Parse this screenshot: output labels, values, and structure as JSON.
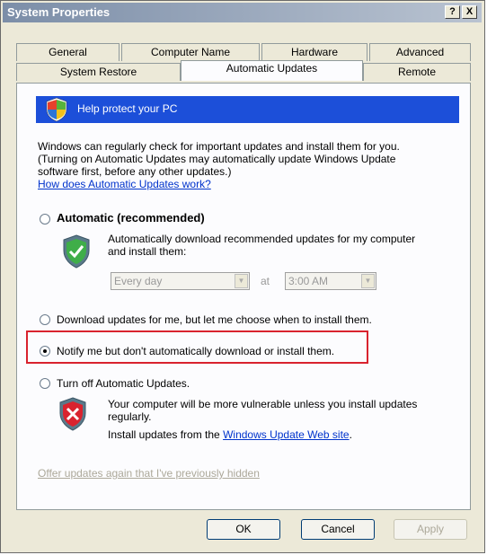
{
  "window": {
    "title": "System Properties",
    "help_button": "?",
    "close_button": "X"
  },
  "tabs": {
    "row1": [
      "General",
      "Computer Name",
      "Hardware",
      "Advanced"
    ],
    "row2": [
      "System Restore",
      "Automatic Updates",
      "Remote"
    ],
    "active": "Automatic Updates"
  },
  "banner": {
    "text": "Help protect your PC",
    "icon": "shield-icon"
  },
  "intro": {
    "line1": "Windows can regularly check for important updates and install them for you.",
    "line2": "(Turning on Automatic Updates may automatically update Windows Update",
    "line3": "software first, before any other updates.)",
    "link": "How does Automatic Updates work?"
  },
  "options": {
    "automatic": {
      "label": "Automatic (recommended)",
      "desc1": "Automatically download recommended updates for my computer",
      "desc2": "and install them:",
      "frequency": "Every day",
      "at_label": "at",
      "time": "3:00 AM",
      "checked": false
    },
    "download": {
      "label": "Download updates for me, but let me choose when to install them.",
      "checked": false
    },
    "notify": {
      "label": "Notify me but don't automatically download or install them.",
      "checked": true
    },
    "off": {
      "label": "Turn off Automatic Updates.",
      "desc1": "Your computer will be more vulnerable unless you install updates",
      "desc2": "regularly.",
      "desc3_prefix": "Install updates from the ",
      "desc3_link": "Windows Update Web site",
      "desc3_suffix": ".",
      "checked": false
    }
  },
  "hidden_link": "Offer updates again that I've previously hidden",
  "buttons": {
    "ok": "OK",
    "cancel": "Cancel",
    "apply": "Apply"
  },
  "colors": {
    "banner": "#1c4fd9",
    "highlight": "#d9232e",
    "link": "#0033cc"
  }
}
